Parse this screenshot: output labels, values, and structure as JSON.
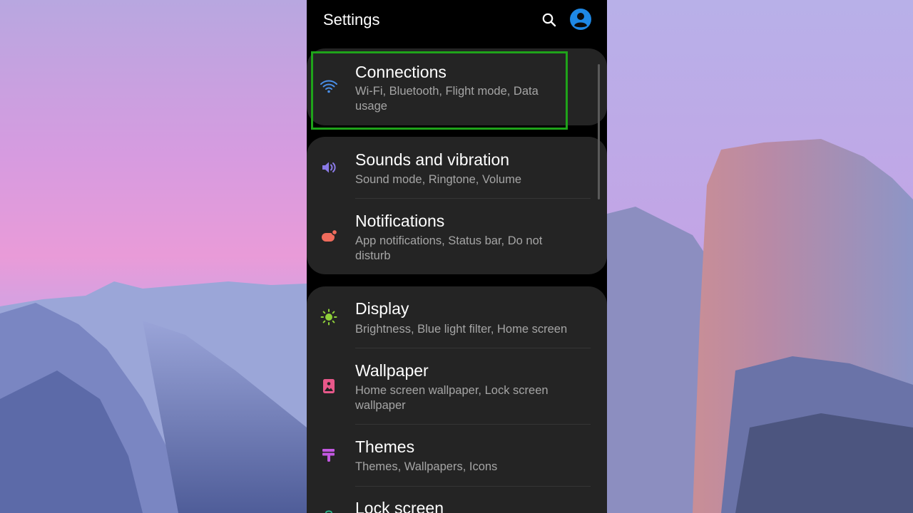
{
  "app": {
    "title": "Settings"
  },
  "toolbar": {
    "search_icon": "search-icon",
    "account_icon": "account-icon"
  },
  "items": [
    {
      "title": "Connections",
      "subtitle": "Wi-Fi, Bluetooth, Flight mode, Data usage",
      "icon": "wifi-icon",
      "icon_color": "#4a8fe8"
    },
    {
      "title": "Sounds and vibration",
      "subtitle": "Sound mode, Ringtone, Volume",
      "icon": "volume-icon",
      "icon_color": "#8a7ae6"
    },
    {
      "title": "Notifications",
      "subtitle": "App notifications, Status bar, Do not disturb",
      "icon": "notifications-icon",
      "icon_color": "#ef6b5c"
    },
    {
      "title": "Display",
      "subtitle": "Brightness, Blue light filter, Home screen",
      "icon": "brightness-icon",
      "icon_color": "#8fd13a"
    },
    {
      "title": "Wallpaper",
      "subtitle": "Home screen wallpaper, Lock screen wallpaper",
      "icon": "wallpaper-icon",
      "icon_color": "#e8588a"
    },
    {
      "title": "Themes",
      "subtitle": "Themes, Wallpapers, Icons",
      "icon": "themes-icon",
      "icon_color": "#c258e0"
    },
    {
      "title": "Lock screen",
      "subtitle": "",
      "icon": "lock-screen-icon",
      "icon_color": "#2bb38a"
    }
  ],
  "highlight": {
    "color": "#1fa31a"
  },
  "colors": {
    "background": "#000000",
    "card": "#242424",
    "title_text": "#ffffff",
    "subtitle_text": "#a5a5a5",
    "accent": "#1e88e5"
  }
}
